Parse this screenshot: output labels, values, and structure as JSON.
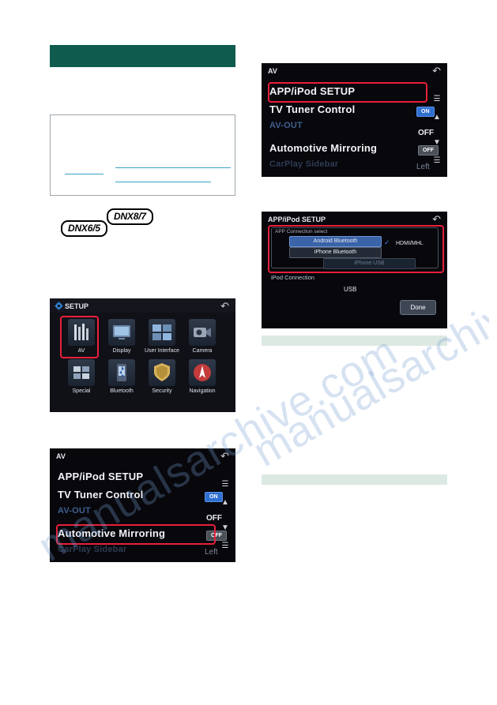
{
  "document": {
    "model_badges": [
      "DNX8/7",
      "DNX6/5"
    ]
  },
  "setup_screen": {
    "title": "SETUP",
    "back_icon": "back-arrow-icon",
    "gear_icon": "gear-icon",
    "items": [
      {
        "label": "AV",
        "icon": "av-icon"
      },
      {
        "label": "Display",
        "icon": "display-icon"
      },
      {
        "label": "User Interface",
        "icon": "user-interface-icon"
      },
      {
        "label": "Camera",
        "icon": "camera-icon"
      },
      {
        "label": "Special",
        "icon": "special-icon"
      },
      {
        "label": "Bluetooth",
        "icon": "bluetooth-icon"
      },
      {
        "label": "Security",
        "icon": "security-icon"
      },
      {
        "label": "Navigation",
        "icon": "navigation-icon"
      }
    ]
  },
  "av_screen_top": {
    "title": "AV",
    "back_icon": "back-arrow-icon",
    "rows": [
      {
        "label": "APP/iPod SETUP",
        "value": ""
      },
      {
        "label": "TV Tuner Control",
        "value": "ON"
      },
      {
        "label": "AV-OUT",
        "value": "OFF"
      },
      {
        "label": "Automotive Mirroring",
        "value": "OFF"
      },
      {
        "label": "CarPlay Sidebar",
        "value": "Left"
      }
    ],
    "scroll_icons": [
      "scroll-top-icon",
      "scroll-up-icon",
      "scroll-down-icon",
      "scroll-bottom-icon"
    ],
    "highlight": "APP/iPod SETUP"
  },
  "av_screen_bottom": {
    "title": "AV",
    "back_icon": "back-arrow-icon",
    "rows": [
      {
        "label": "APP/iPod SETUP",
        "value": ""
      },
      {
        "label": "TV Tuner Control",
        "value": "ON"
      },
      {
        "label": "AV-OUT",
        "value": "OFF"
      },
      {
        "label": "Automotive Mirroring",
        "value": "OFF"
      },
      {
        "label": "CarPlay Sidebar",
        "value": "Left"
      }
    ],
    "scroll_icons": [
      "scroll-top-icon",
      "scroll-up-icon",
      "scroll-down-icon",
      "scroll-bottom-icon"
    ],
    "highlight": "Automotive Mirroring"
  },
  "ipod_setup_screen": {
    "title": "APP/iPod SETUP",
    "back_icon": "back-arrow-icon",
    "app_connection_label": "APP Connection select",
    "options": [
      "Android Bluetooth",
      "iPhone Bluetooth",
      "iPhone USB"
    ],
    "hdmi_label": "HDMI/MHL",
    "ipod_connection_label": "iPod Connection",
    "ipod_connection_value": "USB",
    "done_label": "Done",
    "check_icon": "check-icon"
  },
  "watermark": {
    "line1": "manualsarchive.com",
    "line2": "manualsarchive.com"
  }
}
